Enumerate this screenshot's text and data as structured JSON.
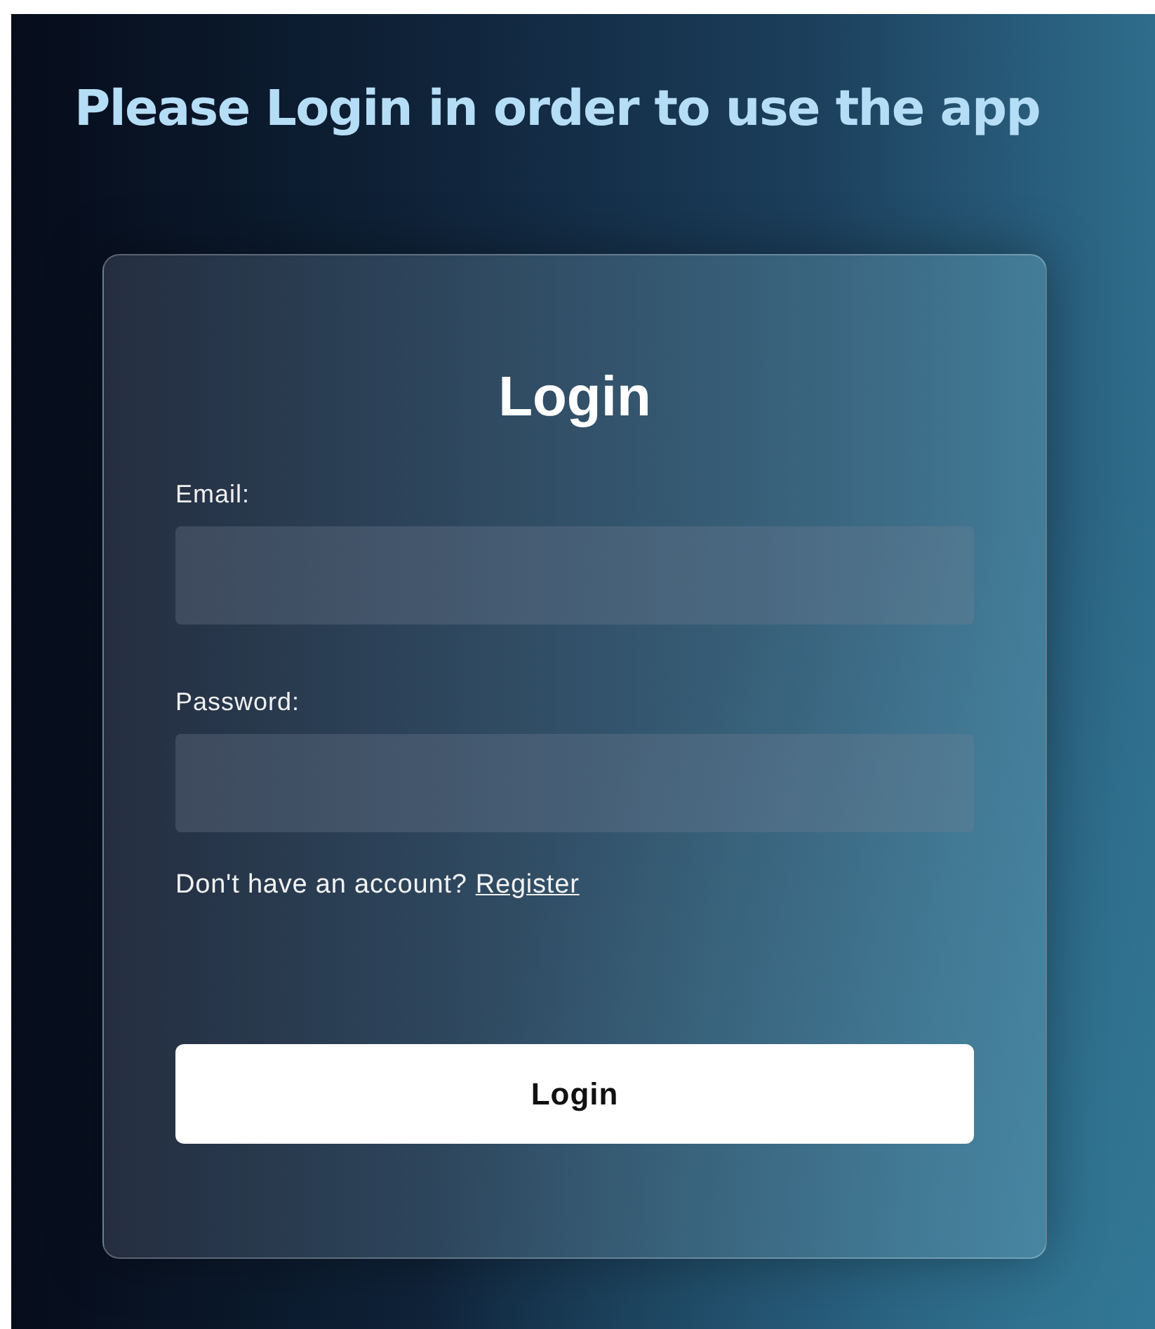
{
  "heading": "Please Login in order to use the app",
  "form": {
    "title": "Login",
    "fields": [
      {
        "label": "Email:"
      },
      {
        "label": "Password:"
      }
    ],
    "register_prompt": "Don't have an account?",
    "register_link": "Register",
    "submit": "Login"
  }
}
